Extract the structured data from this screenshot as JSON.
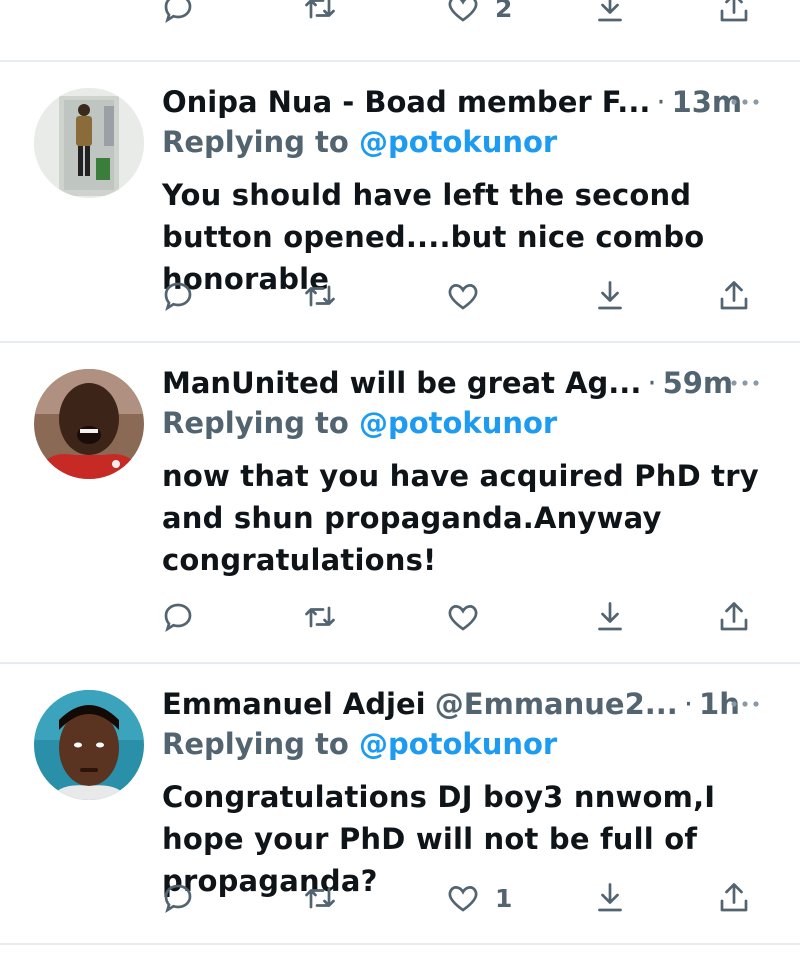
{
  "top_actions": {
    "like_count": "2"
  },
  "tweets": [
    {
      "name": "Onipa Nua - Boad member F...",
      "handle": "",
      "time": "13m",
      "replying_prefix": "Replying to",
      "replying_to": "@potokunor",
      "text": "You should have left the second button opened....but nice combo honorable",
      "like_count": ""
    },
    {
      "name": "ManUnited will be great Ag...",
      "handle": "",
      "time": "59m",
      "replying_prefix": "Replying to",
      "replying_to": "@potokunor",
      "text": "now that you have acquired PhD try and shun propaganda.Anyway congratulations!",
      "like_count": ""
    },
    {
      "name": "Emmanuel Adjei",
      "handle": "@Emmanue2...",
      "time": "1h",
      "replying_prefix": "Replying to",
      "replying_to": "@potokunor",
      "text": "Congratulations DJ boy3 nnwom,I hope your PhD will not be full of propaganda?",
      "like_count": "1"
    }
  ],
  "icons": {
    "reply": "reply-icon",
    "retweet": "retweet-icon",
    "like": "heart-icon",
    "bookmark": "bookmark-download-icon",
    "share": "share-icon",
    "more": "more-dots-icon"
  },
  "colors": {
    "accent": "#1d9bf0",
    "muted": "#536471",
    "text": "#0f1419",
    "divider": "#e6ecf0"
  }
}
